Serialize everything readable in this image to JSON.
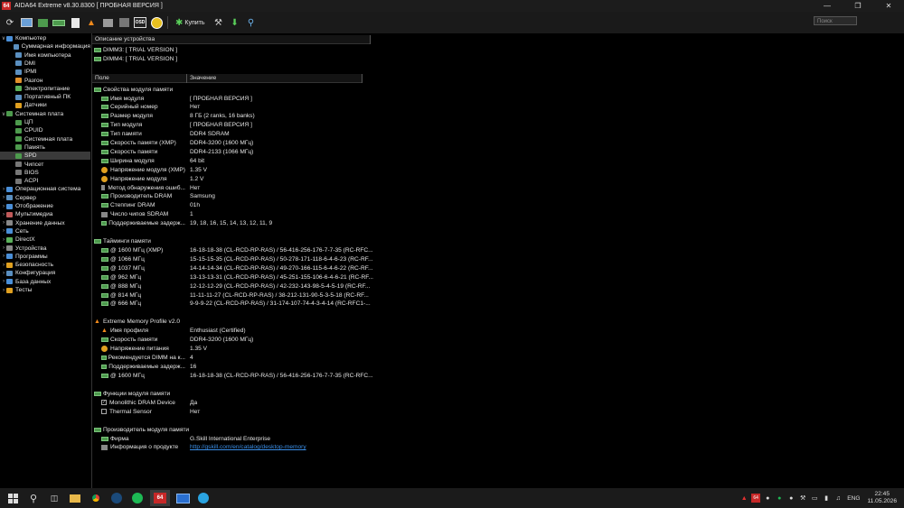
{
  "window": {
    "title": "AIDA64 Extreme v8.30.8300  [ ПРОБНАЯ ВЕРСИЯ ]",
    "app_badge": "64",
    "accent": "#c62828"
  },
  "toolbar": {
    "buy_label": "Купить",
    "search_placeholder": "Поиск",
    "icons": [
      "refresh-icon",
      "computer-icon",
      "motherboard-icon",
      "memory-icon",
      "report-icon",
      "fire-icon",
      "network-icon",
      "disk-icon",
      "osd-icon",
      "aida-logo-icon",
      "buy-icon",
      "tools-icon",
      "download-icon",
      "search-icon"
    ],
    "osd_label": "OSD"
  },
  "sidebar": {
    "items": [
      {
        "label": "Компьютер",
        "level": 0,
        "expanded": true,
        "color": "#4a8fd8"
      },
      {
        "label": "Суммарная информация",
        "level": 1,
        "color": "#5a8fc0"
      },
      {
        "label": "Имя компьютера",
        "level": 1,
        "color": "#5a8fc0"
      },
      {
        "label": "DMI",
        "level": 1,
        "color": "#5a8fc0"
      },
      {
        "label": "IPMI",
        "level": 1,
        "color": "#5a8fc0"
      },
      {
        "label": "Разгон",
        "level": 1,
        "color": "#e0902a"
      },
      {
        "label": "Электропитание",
        "level": 1,
        "color": "#5ab05a"
      },
      {
        "label": "Портативный ПК",
        "level": 1,
        "color": "#5a8fc0"
      },
      {
        "label": "Датчики",
        "level": 1,
        "color": "#e0a020"
      },
      {
        "label": "Системная плата",
        "level": 0,
        "expanded": true,
        "color": "#4d9a4d"
      },
      {
        "label": "ЦП",
        "level": 1,
        "color": "#4d9a4d"
      },
      {
        "label": "CPUID",
        "level": 1,
        "color": "#4d9a4d"
      },
      {
        "label": "Системная плата",
        "level": 1,
        "color": "#4d9a4d"
      },
      {
        "label": "Память",
        "level": 1,
        "color": "#4d9a4d"
      },
      {
        "label": "SPD",
        "level": 1,
        "color": "#4d9a4d",
        "selected": true
      },
      {
        "label": "Чипсет",
        "level": 1,
        "color": "#777"
      },
      {
        "label": "BIOS",
        "level": 1,
        "color": "#777"
      },
      {
        "label": "ACPI",
        "level": 1,
        "color": "#777"
      },
      {
        "label": "Операционная система",
        "level": 0,
        "color": "#4a8fd8"
      },
      {
        "label": "Сервер",
        "level": 0,
        "color": "#5a8fc0"
      },
      {
        "label": "Отображение",
        "level": 0,
        "color": "#4a8fd8"
      },
      {
        "label": "Мультимедиа",
        "level": 0,
        "color": "#c05a5a"
      },
      {
        "label": "Хранение данных",
        "level": 0,
        "color": "#888"
      },
      {
        "label": "Сеть",
        "level": 0,
        "color": "#4a8fd8"
      },
      {
        "label": "DirectX",
        "level": 0,
        "color": "#5ab05a"
      },
      {
        "label": "Устройства",
        "level": 0,
        "color": "#888"
      },
      {
        "label": "Программы",
        "level": 0,
        "color": "#4a8fd8"
      },
      {
        "label": "Безопасность",
        "level": 0,
        "color": "#e0a020"
      },
      {
        "label": "Конфигурация",
        "level": 0,
        "color": "#5a8fc0"
      },
      {
        "label": "База данных",
        "level": 0,
        "color": "#4a8fd8"
      },
      {
        "label": "Тесты",
        "level": 0,
        "color": "#e0a020"
      }
    ]
  },
  "devices": {
    "header": "Описание устройства",
    "items": [
      "DIMM3: [ TRIAL VERSION ]",
      "DIMM4: [ TRIAL VERSION ]"
    ]
  },
  "details": {
    "col_field": "Поле",
    "col_value": "Значение",
    "groups": [
      {
        "title": "Свойства модуля памяти",
        "icon": "ram",
        "rows": [
          {
            "f": "Имя модуля",
            "v": "[ ПРОБНАЯ ВЕРСИЯ ]",
            "icon": "ram"
          },
          {
            "f": "Серийный номер",
            "v": "Нет",
            "icon": "ram"
          },
          {
            "f": "Размер модуля",
            "v": "8 ГБ (2 ranks, 16 banks)",
            "icon": "ram"
          },
          {
            "f": "Тип модуля",
            "v": "[ ПРОБНАЯ ВЕРСИЯ ]",
            "icon": "ram"
          },
          {
            "f": "Тип памяти",
            "v": "DDR4 SDRAM",
            "icon": "ram"
          },
          {
            "f": "Скорость памяти (XMP)",
            "v": "DDR4-3200 (1600 МГц)",
            "icon": "ram"
          },
          {
            "f": "Скорость памяти",
            "v": "DDR4-2133 (1066 МГц)",
            "icon": "ram"
          },
          {
            "f": "Ширина модуля",
            "v": "64 bit",
            "icon": "ram"
          },
          {
            "f": "Напряжение модуля (XMP)",
            "v": "1.35 V",
            "icon": "gauge"
          },
          {
            "f": "Напряжение модуля",
            "v": "1.2 V",
            "icon": "gauge"
          },
          {
            "f": "Метод обнаружения ошиб...",
            "v": "Нет",
            "icon": "info"
          },
          {
            "f": "Производитель DRAM",
            "v": "Samsung",
            "icon": "ram"
          },
          {
            "f": "Степпинг DRAM",
            "v": "01h",
            "icon": "ram"
          },
          {
            "f": "Число чипов SDRAM",
            "v": "1",
            "icon": "info"
          },
          {
            "f": "Поддерживаемые задерж...",
            "v": "19, 18, 16, 15, 14, 13, 12, 11, 9",
            "icon": "ram"
          }
        ]
      },
      {
        "title": "Тайминги памяти",
        "icon": "ram",
        "rows": [
          {
            "f": "@ 1600 МГц (XMP)",
            "v": "16-18-18-38  (CL-RCD-RP-RAS) / 56-416-256-176-7-7-35  (RC-RFC...",
            "icon": "ram"
          },
          {
            "f": "@ 1066 МГц",
            "v": "15-15-15-35  (CL-RCD-RP-RAS) / 50-278-171-118-6-4-6-23  (RC-RF...",
            "icon": "ram"
          },
          {
            "f": "@ 1037 МГц",
            "v": "14-14-14-34  (CL-RCD-RP-RAS) / 49-270-166-115-6-4-6-22  (RC-RF...",
            "icon": "ram"
          },
          {
            "f": "@ 962 МГц",
            "v": "13-13-13-31  (CL-RCD-RP-RAS) / 45-251-155-106-6-4-6-21  (RC-RF...",
            "icon": "ram"
          },
          {
            "f": "@ 888 МГц",
            "v": "12-12-12-29  (CL-RCD-RP-RAS) / 42-232-143-98-5-4-5-19  (RC-RF...",
            "icon": "ram"
          },
          {
            "f": "@ 814 МГц",
            "v": "11-11-11-27  (CL-RCD-RP-RAS) / 38-212-131-90-5-3-5-18  (RC-RF...",
            "icon": "ram"
          },
          {
            "f": "@ 666 МГц",
            "v": "9-9-9-22  (CL-RCD-RP-RAS) / 31-174-107-74-4-3-4-14  (RC-RFC1-...",
            "icon": "ram"
          }
        ]
      },
      {
        "title": "Extreme Memory Profile v2.0",
        "icon": "fire",
        "rows": [
          {
            "f": "Имя профиля",
            "v": "Enthusiast (Certified)",
            "icon": "fire"
          },
          {
            "f": "Скорость памяти",
            "v": "DDR4-3200 (1600 МГц)",
            "icon": "ram"
          },
          {
            "f": "Напряжение питания",
            "v": "1.35 V",
            "icon": "gauge"
          },
          {
            "f": "Рекомендуется DIMM на к...",
            "v": "4",
            "icon": "ram"
          },
          {
            "f": "Поддерживаемые задерж...",
            "v": "16",
            "icon": "ram"
          },
          {
            "f": "@ 1600 МГц",
            "v": "16-18-18-38  (CL-RCD-RP-RAS) / 56-416-256-176-7-7-35  (RC-RFC...",
            "icon": "ram"
          }
        ]
      },
      {
        "title": "Функции модуля памяти",
        "icon": "ram",
        "rows": [
          {
            "f": "Monolithic DRAM Device",
            "v": "Да",
            "icon": "chk-on"
          },
          {
            "f": "Thermal Sensor",
            "v": "Нет",
            "icon": "chk-off"
          }
        ]
      },
      {
        "title": "Производитель модуля памяти",
        "icon": "ram",
        "rows": [
          {
            "f": "Фирма",
            "v": "G.Skill International Enterprise",
            "icon": "ram"
          },
          {
            "f": "Информация о продукте",
            "v": "http://gskill.com/en/catalog/desktop-memory",
            "icon": "info",
            "link": true
          }
        ]
      }
    ]
  },
  "taskbar": {
    "apps": [
      "start-icon",
      "search-icon",
      "task-view-icon",
      "file-explorer-icon",
      "chrome-icon",
      "steam-icon",
      "spotify-icon",
      "aida64-icon",
      "remote-desktop-icon",
      "telegram-icon"
    ],
    "aida_badge": "64",
    "language": "ENG",
    "time": "22:45",
    "date": "11.05.2026"
  }
}
